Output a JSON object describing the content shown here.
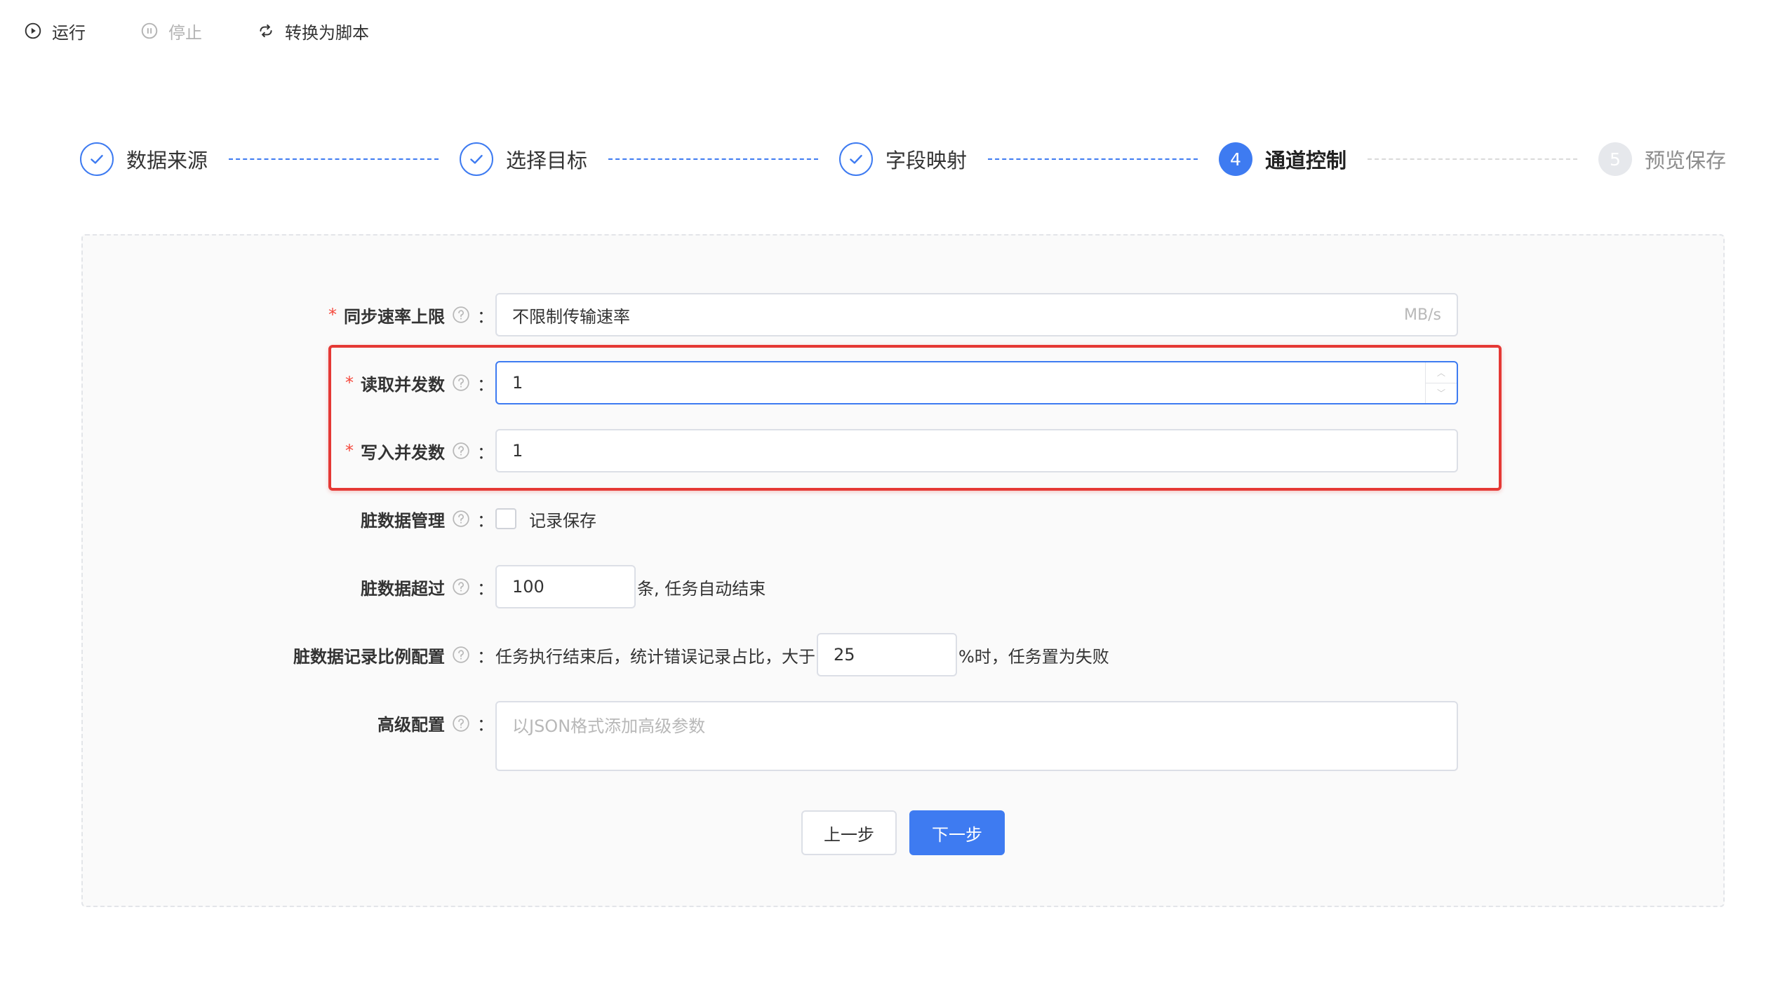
{
  "toolbar": {
    "run_label": "运行",
    "stop_label": "停止",
    "convert_label": "转换为脚本"
  },
  "steps": [
    {
      "label": "数据来源",
      "state": "done"
    },
    {
      "label": "选择目标",
      "state": "done"
    },
    {
      "label": "字段映射",
      "state": "done"
    },
    {
      "label": "通道控制",
      "state": "active",
      "number": "4"
    },
    {
      "label": "预览保存",
      "state": "todo",
      "number": "5"
    }
  ],
  "form": {
    "sync_rate": {
      "label": "同步速率上限",
      "required": "*",
      "value": "不限制传输速率",
      "suffix": "MB/s"
    },
    "read_concurrency": {
      "label": "读取并发数",
      "required": "*",
      "value": "1"
    },
    "write_concurrency": {
      "label": "写入并发数",
      "required": "*",
      "value": "1"
    },
    "dirty_data": {
      "label": "脏数据管理",
      "checkbox_label": "记录保存"
    },
    "dirty_exceed": {
      "label": "脏数据超过",
      "value": "100",
      "suffix": "条, 任务自动结束"
    },
    "dirty_ratio": {
      "label": "脏数据记录比例配置",
      "prefix": "任务执行结束后，统计错误记录占比，大于",
      "value": "25",
      "suffix": "%时，任务置为失败"
    },
    "advanced": {
      "label": "高级配置",
      "placeholder": "以JSON格式添加高级参数"
    },
    "colon": "："
  },
  "buttons": {
    "prev_label": "上一步",
    "next_label": "下一步"
  },
  "colors": {
    "primary": "#3e7bf1",
    "required": "#f5493d",
    "highlight": "#e53935"
  }
}
